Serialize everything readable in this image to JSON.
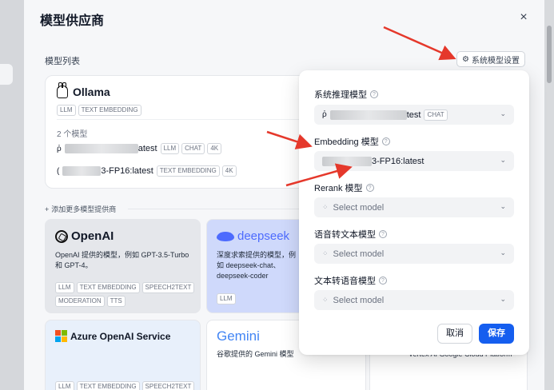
{
  "dialog": {
    "title": "模型供应商",
    "close": "×",
    "model_list_label": "模型列表",
    "system_model_button": "系统模型设置",
    "add_more": "添加更多模型提供商"
  },
  "ollama": {
    "name": "Ollama",
    "tags": [
      "LLM",
      "TEXT EMBEDDING"
    ],
    "model_count": "2 个模型",
    "models": [
      {
        "suffix": "atest",
        "tags": [
          "LLM",
          "CHAT",
          "4K"
        ]
      },
      {
        "suffix": "3-FP16:latest",
        "tags": [
          "TEXT EMBEDDING",
          "4K"
        ]
      }
    ]
  },
  "providers": {
    "openai": {
      "name": "OpenAI",
      "desc": "OpenAI 提供的模型，例如 GPT-3.5-Turbo 和 GPT-4。",
      "tags": [
        "LLM",
        "TEXT EMBEDDING",
        "SPEECH2TEXT",
        "MODERATION",
        "TTS"
      ]
    },
    "deepseek": {
      "name": "deepseek",
      "desc": "深度求索提供的模型，例如 deepseek-chat、deepseek-coder",
      "tags": [
        "LLM"
      ]
    },
    "azure": {
      "name": "Azure OpenAI Service",
      "tags": [
        "LLM",
        "TEXT EMBEDDING",
        "SPEECH2TEXT"
      ]
    },
    "gemini": {
      "name": "Gemini",
      "desc": "谷歌提供的 Gemini 模型"
    },
    "vertex": {
      "desc": "Vertex AI Google Cloud Platform"
    }
  },
  "popover": {
    "fields": [
      {
        "label": "系统推理模型",
        "value_suffix": "test",
        "value_tag": "CHAT"
      },
      {
        "label": "Embedding 模型",
        "value_suffix": "3-FP16:latest"
      },
      {
        "label": "Rerank 模型",
        "placeholder": "Select model"
      },
      {
        "label": "语音转文本模型",
        "placeholder": "Select model"
      },
      {
        "label": "文本转语音模型",
        "placeholder": "Select model"
      }
    ],
    "cancel": "取消",
    "save": "保存"
  },
  "colors": {
    "primary": "#155eef",
    "arrow": "#e5382b",
    "deepseek": "#4d6bfe"
  }
}
